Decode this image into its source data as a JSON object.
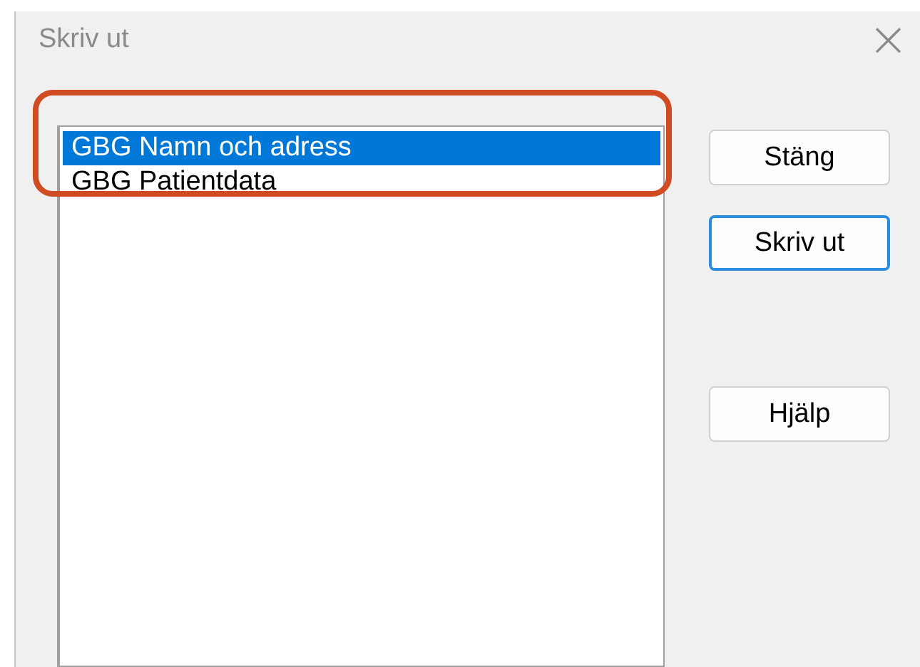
{
  "window": {
    "title": "Skriv ut",
    "close": "×"
  },
  "list": {
    "items": [
      {
        "label": "GBG Namn och adress",
        "selected": true
      },
      {
        "label": "GBG Patientdata",
        "selected": false
      }
    ]
  },
  "buttons": [
    {
      "label": "Stäng",
      "default": false
    },
    {
      "label": "Skriv ut",
      "default": true
    },
    {
      "label": "Hjälp",
      "default": false
    }
  ],
  "highlight": {
    "kind": "rounded-rect"
  }
}
